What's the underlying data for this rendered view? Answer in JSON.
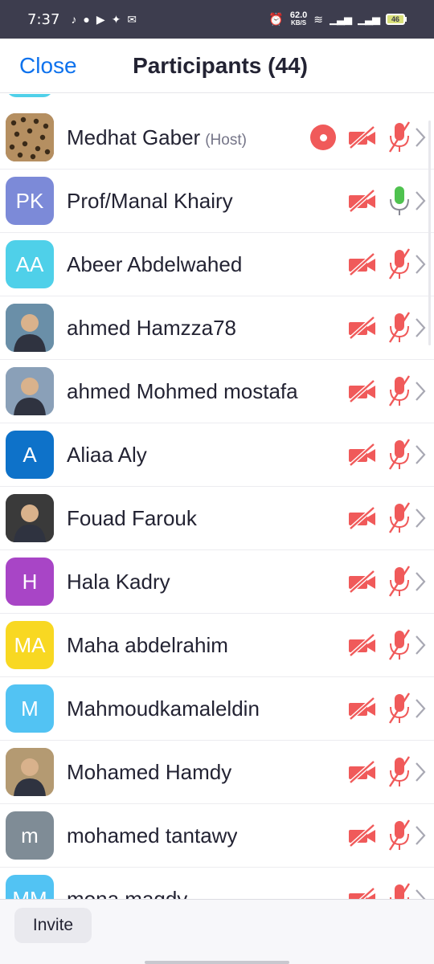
{
  "status_bar": {
    "time": "7:37",
    "net_speed_value": "62.0",
    "net_speed_unit": "KB/S",
    "battery": "46",
    "icons": [
      "tiktok-icon",
      "facebook-icon",
      "youtube-icon",
      "twitter-icon",
      "gmail-icon",
      "alarm-icon",
      "wifi-icon",
      "signal-icon",
      "signal-icon"
    ]
  },
  "header": {
    "close_label": "Close",
    "title": "Participants (44)"
  },
  "participants": [
    {
      "name": "Medhat Gaber",
      "host_tag": "(Host)",
      "initials": "",
      "avatar_color": "#a07850",
      "photo": "leopard",
      "recording": true,
      "mic": "muted"
    },
    {
      "name": "Prof/Manal Khairy",
      "initials": "PK",
      "avatar_color": "#7c8ad8",
      "mic": "active"
    },
    {
      "name": "Abeer Abdelwahed",
      "initials": "AA",
      "avatar_color": "#4fd0e9",
      "mic": "muted"
    },
    {
      "name": "ahmed Hamzza78",
      "initials": "",
      "avatar_color": "#6a8fa8",
      "photo": "person",
      "mic": "muted"
    },
    {
      "name": "ahmed Mohmed mostafa",
      "initials": "",
      "avatar_color": "#8aa0b8",
      "photo": "person",
      "mic": "muted"
    },
    {
      "name": "Aliaa Aly",
      "initials": "A",
      "avatar_color": "#0e72c9",
      "mic": "muted"
    },
    {
      "name": "Fouad Farouk",
      "initials": "",
      "avatar_color": "#3a3a3a",
      "photo": "person",
      "mic": "muted"
    },
    {
      "name": "Hala Kadry",
      "initials": "H",
      "avatar_color": "#a845c6",
      "mic": "muted"
    },
    {
      "name": "Maha abdelrahim",
      "initials": "MA",
      "avatar_color": "#f8d822",
      "mic": "muted"
    },
    {
      "name": "Mahmoudkamaleldin",
      "initials": "M",
      "avatar_color": "#52c3f3",
      "mic": "muted"
    },
    {
      "name": "Mohamed Hamdy",
      "initials": "",
      "avatar_color": "#b49a72",
      "photo": "person",
      "mic": "muted"
    },
    {
      "name": "mohamed tantawy",
      "initials": "m",
      "avatar_color": "#7f8c96",
      "mic": "muted"
    },
    {
      "name": "mona magdy",
      "initials": "MM",
      "avatar_color": "#52c3f3",
      "mic": "muted"
    }
  ],
  "footer": {
    "invite_label": "Invite"
  },
  "colors": {
    "accent": "#0e72ed",
    "muted_red": "#f05a5a",
    "mic_active": "#4fc24f"
  }
}
